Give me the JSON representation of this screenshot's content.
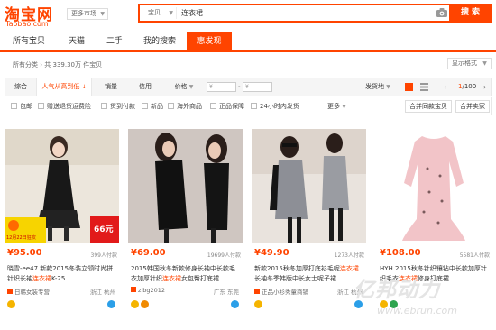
{
  "header": {
    "logo_cn": "淘宝网",
    "logo_en": "Taobao.com",
    "market_label": "更多市场",
    "search": {
      "scope": "宝贝",
      "query": "连衣裙",
      "button": "搜索"
    },
    "colors": {
      "brand": "#ff4400"
    }
  },
  "tabs": [
    "所有宝贝",
    "天猫",
    "二手",
    "我的搜索",
    "惠发现"
  ],
  "active_tab": 4,
  "result_info": {
    "category": "所有分类",
    "count_text": "共 339.30万 件宝贝"
  },
  "display_format": "显示格式",
  "sortbar": {
    "items": [
      "综合",
      "人气从高到低",
      "销量",
      "信用",
      "价格"
    ],
    "active": 1,
    "price_min_placeholder": "¥",
    "price_max_placeholder": "¥",
    "ship_from": "发货地",
    "page_current": "1",
    "page_total": "/100"
  },
  "filters": {
    "checks": [
      "包邮",
      "赠送退货运费险",
      "货到付款",
      "新品",
      "海外商品",
      "正品保障",
      "24小时内发货"
    ],
    "more": "更多",
    "merge_button": "合并同款宝贝",
    "sellers_button": "合并卖家"
  },
  "products": [
    {
      "price": "95.00",
      "paid": "399人付款",
      "title_pre": "晓雪-ee47 新款2015冬装立领时尚拼针织长袖",
      "title_hl": "连衣裙",
      "title_post": "K-25",
      "shop": "日韩女装专营",
      "location": "浙江 杭州",
      "promo_left": "12月22日狂欢",
      "promo_right": "66元"
    },
    {
      "price": "69.00",
      "paid": "19699人付款",
      "title_pre": "2015韩国秋冬新款修身长袖中长款毛衣加厚针织",
      "title_hl": "连衣裙",
      "title_post": "女包臀打底裙",
      "shop": "zlbg2012",
      "location": "广东 东莞"
    },
    {
      "price": "49.90",
      "paid": "1273人付款",
      "title_pre": "新款2015秋冬加厚打底衫毛呢",
      "title_hl": "连衣裙",
      "title_post": "长袖冬季韩版中长女士呢子裙",
      "shop": "正品小衫秀童商铺",
      "location": "浙江 杭州"
    },
    {
      "price": "108.00",
      "paid": "5581人付款",
      "title_pre": "HYH 2015秋冬针织镶钻中长款加厚针织毛衣",
      "title_hl": "连衣裙",
      "title_post": "修身打底裙",
      "shop": "",
      "location": ""
    }
  ],
  "watermark": {
    "main": "亿邦动力",
    "url": "www.ebrun.com"
  }
}
